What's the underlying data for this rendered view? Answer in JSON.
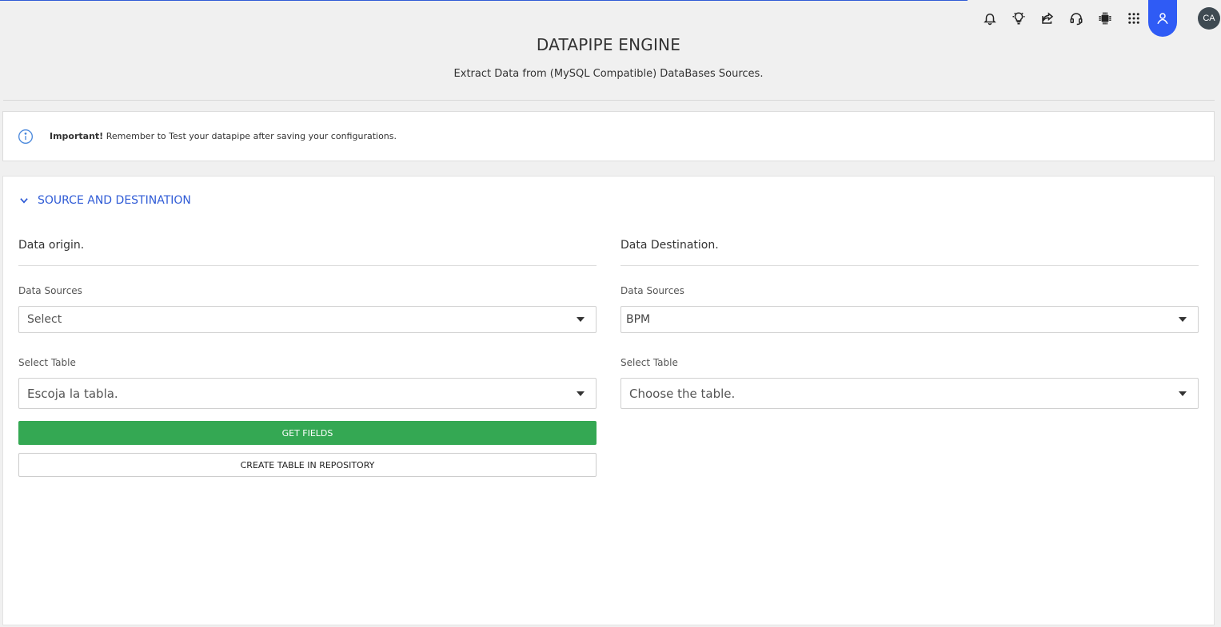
{
  "header": {
    "title": "DATAPIPE ENGINE",
    "subtitle": "Extract Data from (MySQL Compatible) DataBases Sources."
  },
  "toolbar": {
    "icons": [
      "bell-icon",
      "lightbulb-icon",
      "share-icon",
      "headset-icon",
      "chip-icon",
      "apps-grid-icon",
      "user-profile-icon"
    ],
    "avatar_initials": "CA",
    "accent_color": "#2f5bf5"
  },
  "alert": {
    "icon": "info-icon",
    "strong": "Important!",
    "message": " Remember to Test your datapipe after saving your configurations."
  },
  "section": {
    "title": "SOURCE AND DESTINATION",
    "icon": "chevron-down-icon"
  },
  "origin": {
    "title": "Data origin.",
    "sources_label": "Data Sources",
    "sources_value": "Select",
    "table_label": "Select Table",
    "table_value": "Escoja la tabla.",
    "get_fields_label": "GET FIELDS",
    "create_table_label": "CREATE TABLE IN REPOSITORY"
  },
  "destination": {
    "title": "Data Destination.",
    "sources_label": "Data Sources",
    "sources_value": "BPM",
    "table_label": "Select Table",
    "table_value": "Choose the table."
  },
  "colors": {
    "brand_blue": "#2f5bd6",
    "success_green": "#34a853"
  }
}
